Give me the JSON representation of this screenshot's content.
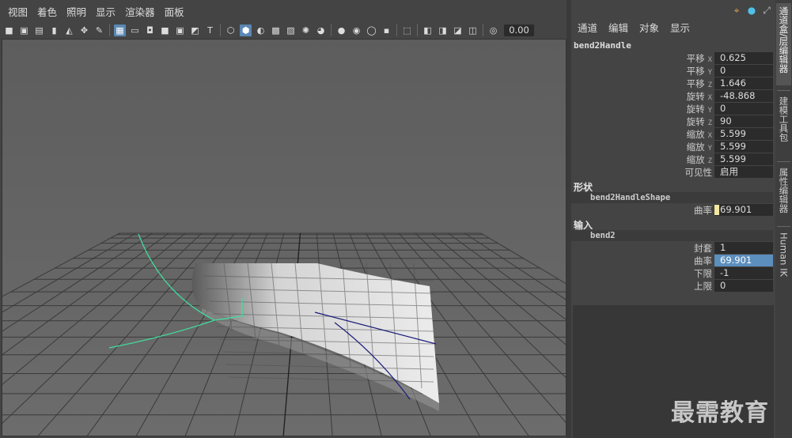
{
  "menubar": {
    "items": [
      "视图",
      "着色",
      "照明",
      "显示",
      "渲染器",
      "面板"
    ]
  },
  "toolbar": {
    "groups": [
      [
        "camera-icon",
        "camera-lock-icon",
        "camera-attr-icon",
        "bookmark-icon",
        "image-plane-icon",
        "move-cam-icon",
        "pen-icon"
      ],
      [
        "grid-icon",
        "film-gate-icon",
        "resolution-gate-icon",
        "gate-mask-icon",
        "field-chart-icon",
        "safe-title-icon"
      ],
      [
        "wireframe-cube-icon",
        "smooth-shade-icon",
        "shade-wire-icon",
        "bounding-box-icon",
        "texture-icon",
        "light-icon",
        "shadow-icon"
      ],
      [
        "ambient-occlusion-icon",
        "motion-blur-icon",
        "aa-icon",
        "depth-icon"
      ],
      [
        "isolate-icon"
      ],
      [
        "xray-icon",
        "xray-active-icon",
        "xray-joints-icon",
        "xray-backface-icon"
      ],
      [
        "exposure-icon"
      ]
    ],
    "exposure_value": "0.00"
  },
  "channel_box": {
    "menus": [
      "通道",
      "编辑",
      "对象",
      "显示"
    ],
    "node_name": "bend2Handle",
    "attributes": [
      {
        "label": "平移",
        "axis": "X",
        "value": "0.625"
      },
      {
        "label": "平移",
        "axis": "Y",
        "value": "0"
      },
      {
        "label": "平移",
        "axis": "Z",
        "value": "1.646"
      },
      {
        "label": "旋转",
        "axis": "X",
        "value": "-48.868"
      },
      {
        "label": "旋转",
        "axis": "Y",
        "value": "0"
      },
      {
        "label": "旋转",
        "axis": "Z",
        "value": "90"
      },
      {
        "label": "缩放",
        "axis": "X",
        "value": "5.599"
      },
      {
        "label": "缩放",
        "axis": "Y",
        "value": "5.599"
      },
      {
        "label": "缩放",
        "axis": "Z",
        "value": "5.599"
      },
      {
        "label": "可见性",
        "axis": "",
        "value": "启用"
      }
    ],
    "shapes_header": "形状",
    "shape_name": "bend2HandleShape",
    "shape_attributes": [
      {
        "label": "曲率",
        "value": "69.901"
      }
    ],
    "inputs_header": "输入",
    "input_name": "bend2",
    "input_attributes": [
      {
        "label": "封套",
        "value": "1"
      },
      {
        "label": "曲率",
        "value": "69.901",
        "selected": true
      },
      {
        "label": "下限",
        "value": "-1"
      },
      {
        "label": "上限",
        "value": "0"
      }
    ]
  },
  "side_tabs": [
    "通道盒/层编辑器",
    "建模工具包",
    "属性编辑器",
    "Human IK"
  ],
  "watermark": "最需教育",
  "colors": {
    "viewport_bg": "#676767",
    "panel_bg": "#444444",
    "field_bg": "#2b2b2b",
    "selected_field": "#5c8fbd",
    "handle_green": "#3fe0a0",
    "handle_blue": "#1c1c7a",
    "plane_light": "#d8d8d8"
  }
}
